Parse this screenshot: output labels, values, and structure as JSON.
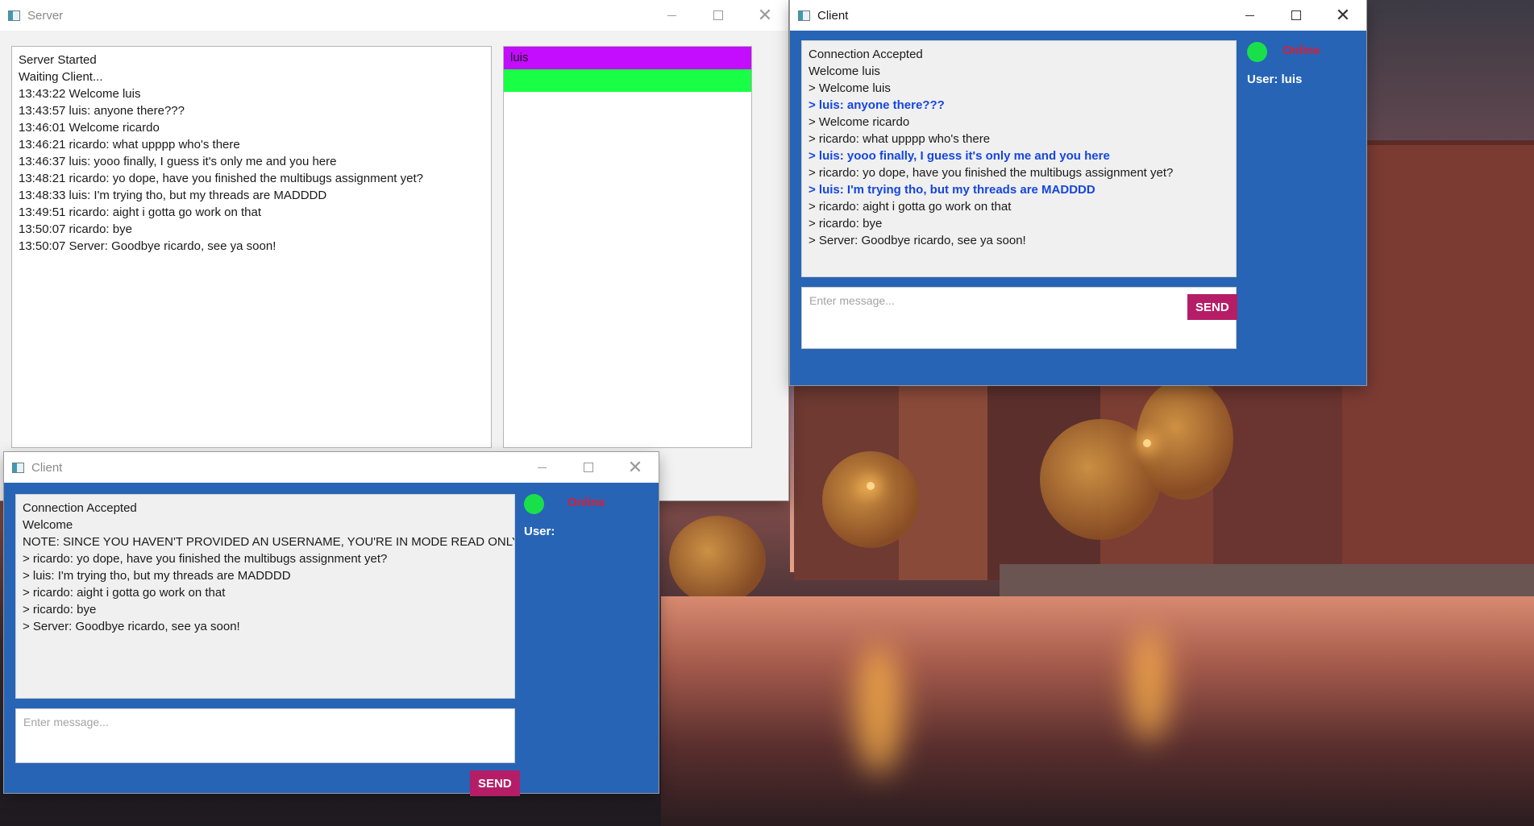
{
  "server": {
    "title": "Server",
    "log": [
      "Server Started",
      "Waiting Client...",
      "13:43:22 Welcome luis",
      "13:43:57 luis: anyone there???",
      "13:46:01 Welcome ricardo",
      "13:46:21 ricardo: what upppp who's there",
      "13:46:37 luis: yooo finally, I guess it's only me and you here",
      "13:48:21 ricardo: yo dope, have you finished the multibugs assignment yet?",
      "13:48:33 luis: I'm trying tho, but my threads are MADDDD",
      "13:49:51 ricardo: aight i gotta go work on that",
      "13:50:07 ricardo: bye",
      "13:50:07 Server: Goodbye ricardo, see ya soon!"
    ],
    "users": [
      {
        "name": "luis",
        "color": "#c40cff"
      },
      {
        "name": "",
        "color": "#19ff46"
      }
    ]
  },
  "client_luis": {
    "title": "Client",
    "status": "Online",
    "status_color": "#d61f3a",
    "user_label": "User: luis",
    "log": [
      {
        "text": "Connection Accepted",
        "self": false
      },
      {
        "text": "Welcome luis",
        "self": false
      },
      {
        "text": "> Welcome luis",
        "self": false
      },
      {
        "text": "> luis: anyone there???",
        "self": true
      },
      {
        "text": "> Welcome ricardo",
        "self": false
      },
      {
        "text": "> ricardo: what upppp who's there",
        "self": false
      },
      {
        "text": "> luis: yooo finally, I guess it's only me and you here",
        "self": true
      },
      {
        "text": "> ricardo: yo dope, have you finished the multibugs assignment yet?",
        "self": false
      },
      {
        "text": "> luis: I'm trying tho, but my threads are MADDDD",
        "self": true
      },
      {
        "text": "> ricardo: aight i gotta go work on that",
        "self": false
      },
      {
        "text": "> ricardo: bye",
        "self": false
      },
      {
        "text": "> Server: Goodbye ricardo, see ya soon!",
        "self": false
      }
    ],
    "input_placeholder": "Enter message...",
    "send_label": "SEND"
  },
  "client_anon": {
    "title": "Client",
    "status": "Online",
    "user_label": "User:",
    "log": [
      {
        "text": "Connection Accepted",
        "self": false
      },
      {
        "text": "Welcome",
        "self": false
      },
      {
        "text": "NOTE: SINCE YOU HAVEN'T PROVIDED AN USERNAME, YOU'RE IN MODE READ ONLY.",
        "self": false
      },
      {
        "text": "> ricardo: yo dope, have you finished the multibugs assignment yet?",
        "self": false
      },
      {
        "text": "> luis: I'm trying tho, but my threads are MADDDD",
        "self": false
      },
      {
        "text": "> ricardo: aight i gotta go work on that",
        "self": false
      },
      {
        "text": "> ricardo: bye",
        "self": false
      },
      {
        "text": "> Server: Goodbye ricardo, see ya soon!",
        "self": false
      }
    ],
    "input_placeholder": "Enter message...",
    "send_label": "SEND"
  },
  "colors": {
    "client_panel": "#2764b5",
    "send_button": "#b51e66",
    "online_dot": "#19e04a",
    "self_message": "#1546e0"
  }
}
